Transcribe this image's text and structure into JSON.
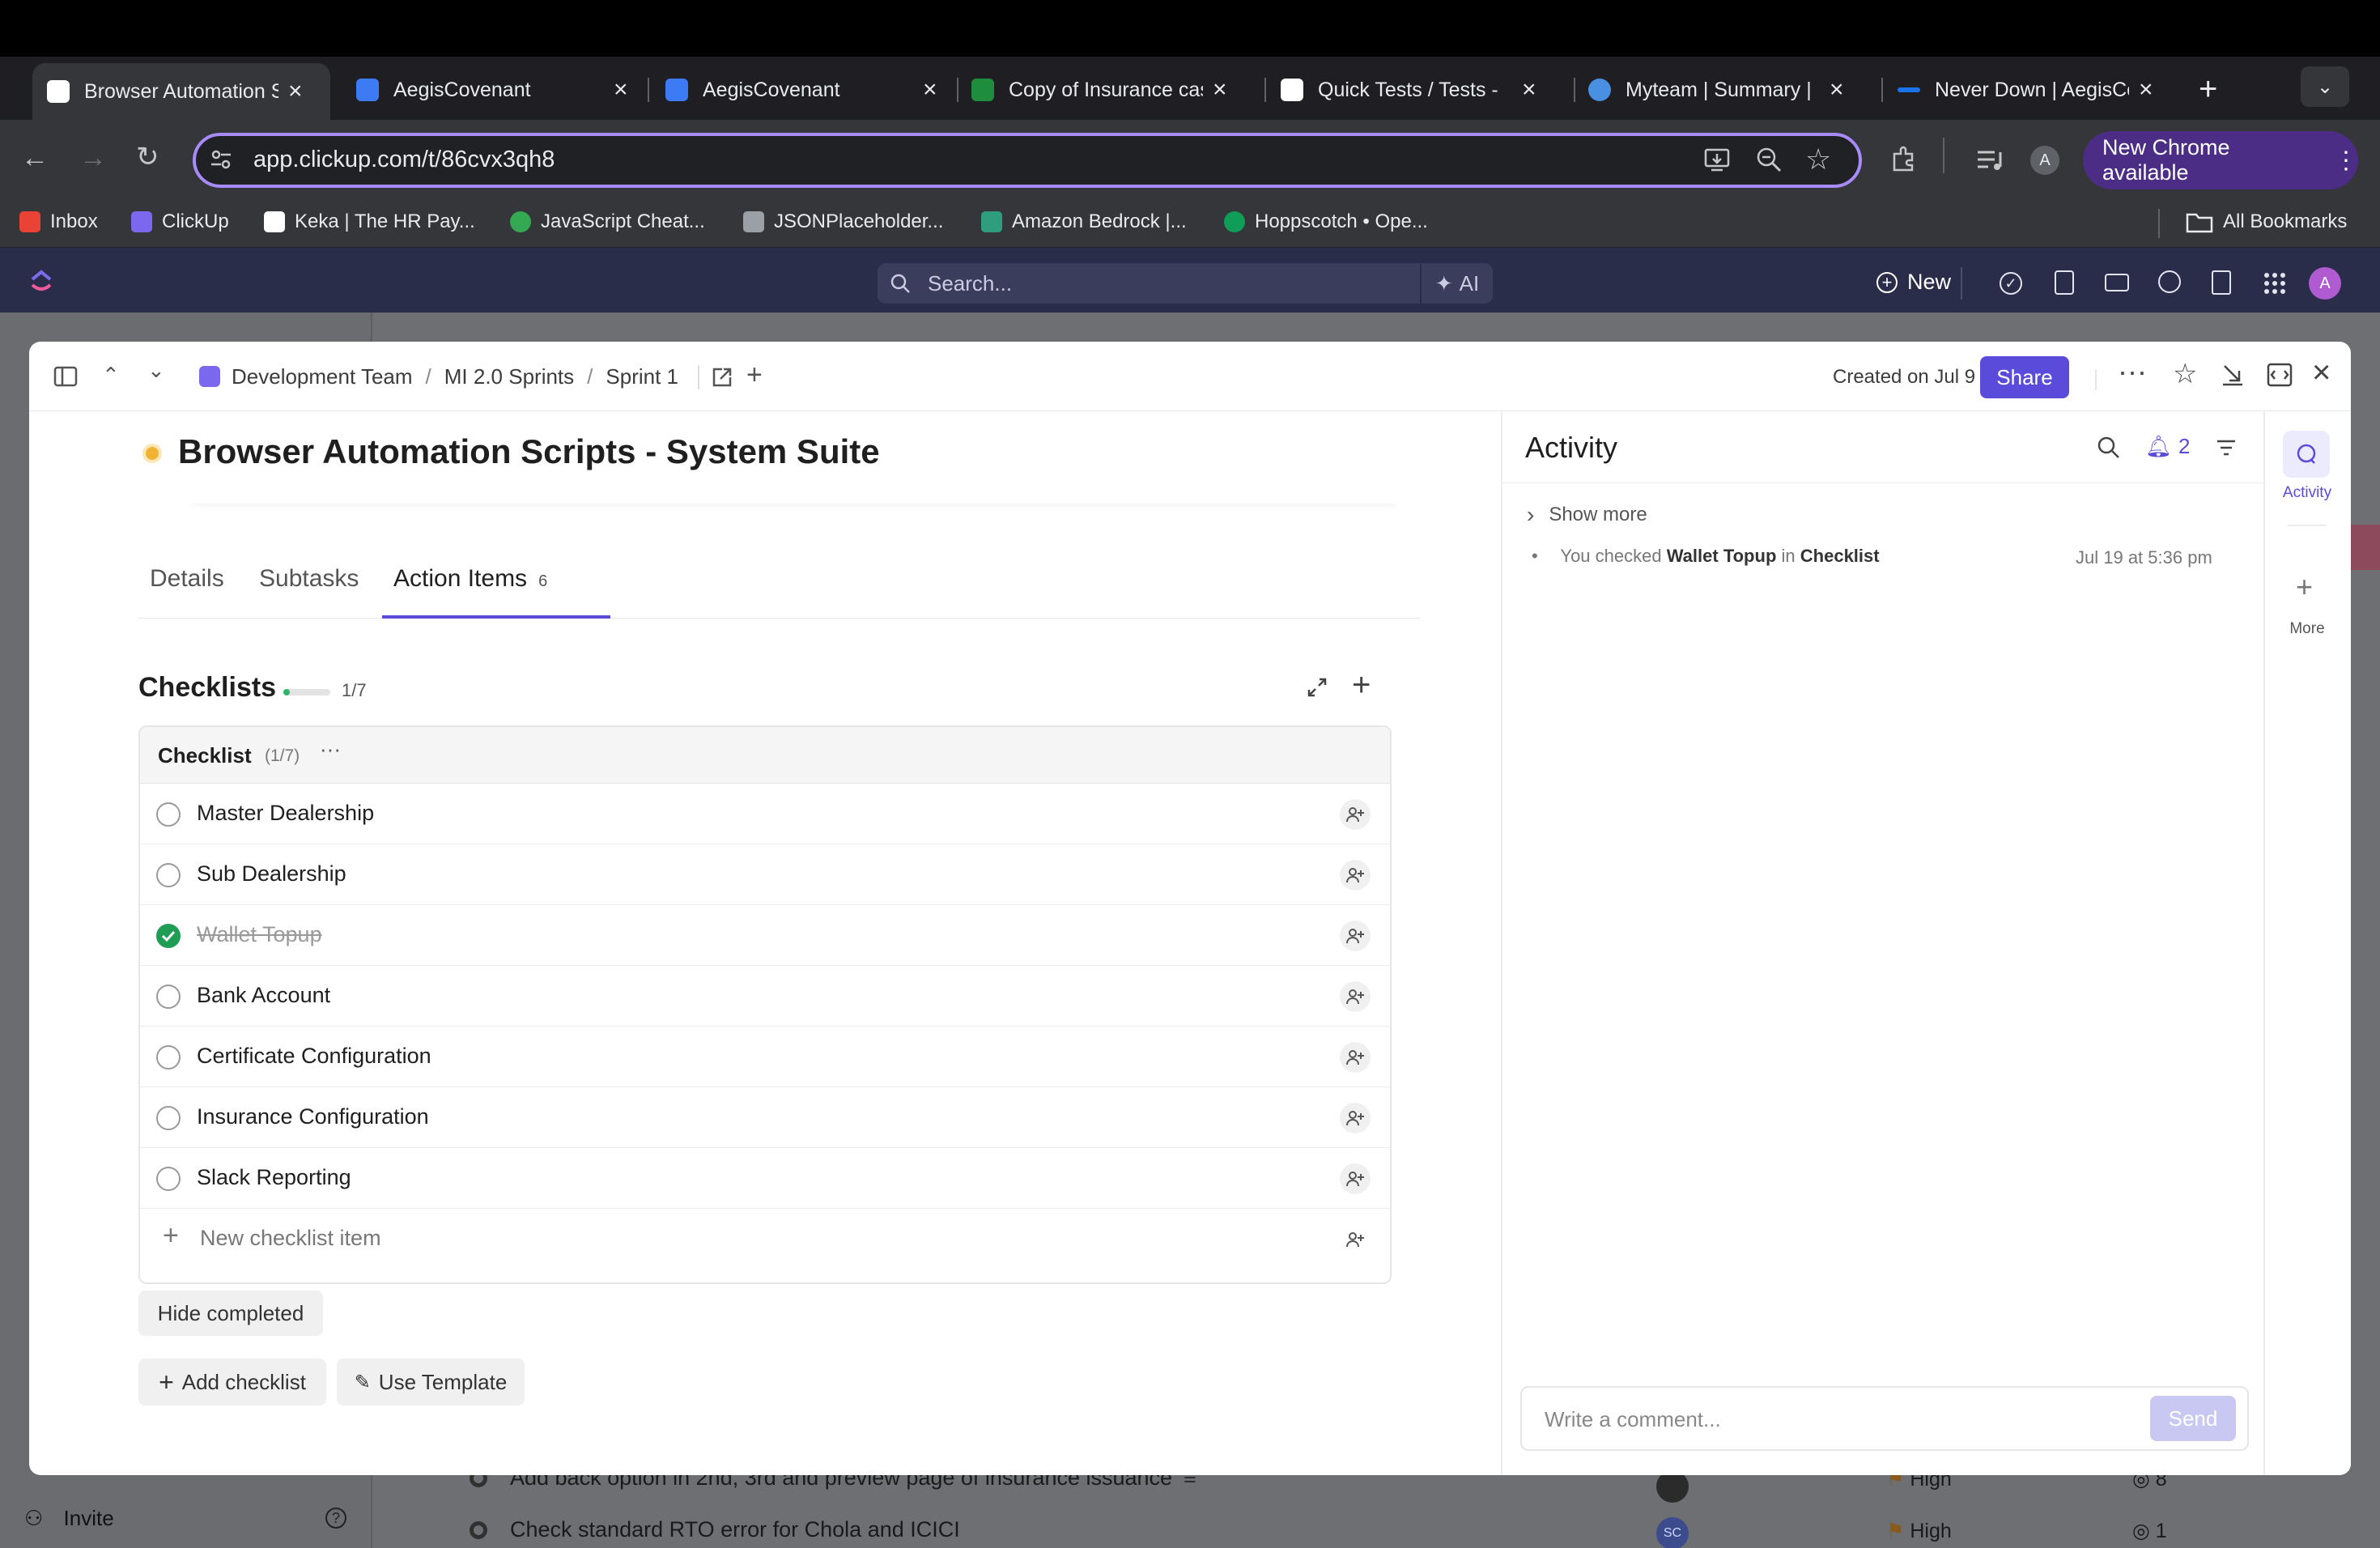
{
  "browser": {
    "tabs": [
      {
        "title": "Browser Automation Scripts",
        "favicon_color": "#ffffff",
        "active": true
      },
      {
        "title": "AegisCovenant",
        "favicon_color": "#3d7bf5"
      },
      {
        "title": "AegisCovenant",
        "favicon_color": "#3d7bf5"
      },
      {
        "title": "Copy of Insurance cases",
        "favicon_color": "#1e8e3e"
      },
      {
        "title": "Quick Tests / Tests -",
        "favicon_color": "#ffffff"
      },
      {
        "title": "Myteam | Summary |",
        "favicon_color": "#4a90e2"
      },
      {
        "title": "Never Down | AegisCovenant",
        "favicon_color": "#1a73e8"
      }
    ],
    "url": "app.clickup.com/t/86cvx3qh8",
    "profile_initial": "A",
    "new_chrome_label": "New Chrome available",
    "bookmarks": [
      {
        "label": "Inbox",
        "color": "#ea4335"
      },
      {
        "label": "ClickUp",
        "color": "#7b68ee"
      },
      {
        "label": "Keka | The HR Pay...",
        "color": "#ffffff"
      },
      {
        "label": "JavaScript Cheat...",
        "color": "#34a853"
      },
      {
        "label": "JSONPlaceholder...",
        "color": "#9aa0a6"
      },
      {
        "label": "Amazon Bedrock |...",
        "color": "#2e9e7e"
      },
      {
        "label": "Hoppscotch • Ope...",
        "color": "#0f9d58"
      }
    ],
    "all_bookmarks": "All Bookmarks"
  },
  "clickup_bar": {
    "search_placeholder": "Search...",
    "ai_label": "AI",
    "new_label": "New",
    "avatar_initial": "A"
  },
  "background": {
    "rows": [
      {
        "title": "Add back option in 2nd, 3rd and preview page of insurance issuance",
        "priority": "High",
        "points": "8"
      },
      {
        "title": "Check standard RTO error for Chola and ICICI",
        "priority": "High",
        "points": "1",
        "assignee": "SC"
      }
    ],
    "invite_label": "Invite"
  },
  "modal": {
    "breadcrumb": [
      "Development Team",
      "MI 2.0 Sprints",
      "Sprint 1"
    ],
    "created": "Created on Jul 9",
    "share_label": "Share",
    "task_title": "Browser Automation Scripts - System Suite",
    "status_color": "#f2b233",
    "tabs": [
      {
        "label": "Details"
      },
      {
        "label": "Subtasks"
      },
      {
        "label": "Action Items",
        "count": "6",
        "active": true
      }
    ],
    "checklists": {
      "title": "Checklists",
      "progress_text": "1/7",
      "progress_fraction": 0.142,
      "list_name": "Checklist",
      "list_count": "(1/7)",
      "items": [
        {
          "label": "Master Dealership",
          "done": false
        },
        {
          "label": "Sub Dealership",
          "done": false
        },
        {
          "label": "Wallet Topup",
          "done": true
        },
        {
          "label": "Bank Account",
          "done": false
        },
        {
          "label": "Certificate Configuration",
          "done": false
        },
        {
          "label": "Insurance Configuration",
          "done": false
        },
        {
          "label": "Slack Reporting",
          "done": false
        }
      ],
      "new_item_placeholder": "New checklist item",
      "hide_completed": "Hide completed",
      "add_checklist": "Add checklist",
      "use_template": "Use Template"
    },
    "activity": {
      "title": "Activity",
      "notification_count": "2",
      "show_more": "Show more",
      "entry": {
        "prefix": "You checked",
        "item": "Wallet Topup",
        "middle": "in",
        "target": "Checklist",
        "time": "Jul 19 at 5:36 pm"
      },
      "comment_placeholder": "Write a comment...",
      "send_label": "Send",
      "rail_activity": "Activity",
      "rail_more": "More"
    }
  }
}
